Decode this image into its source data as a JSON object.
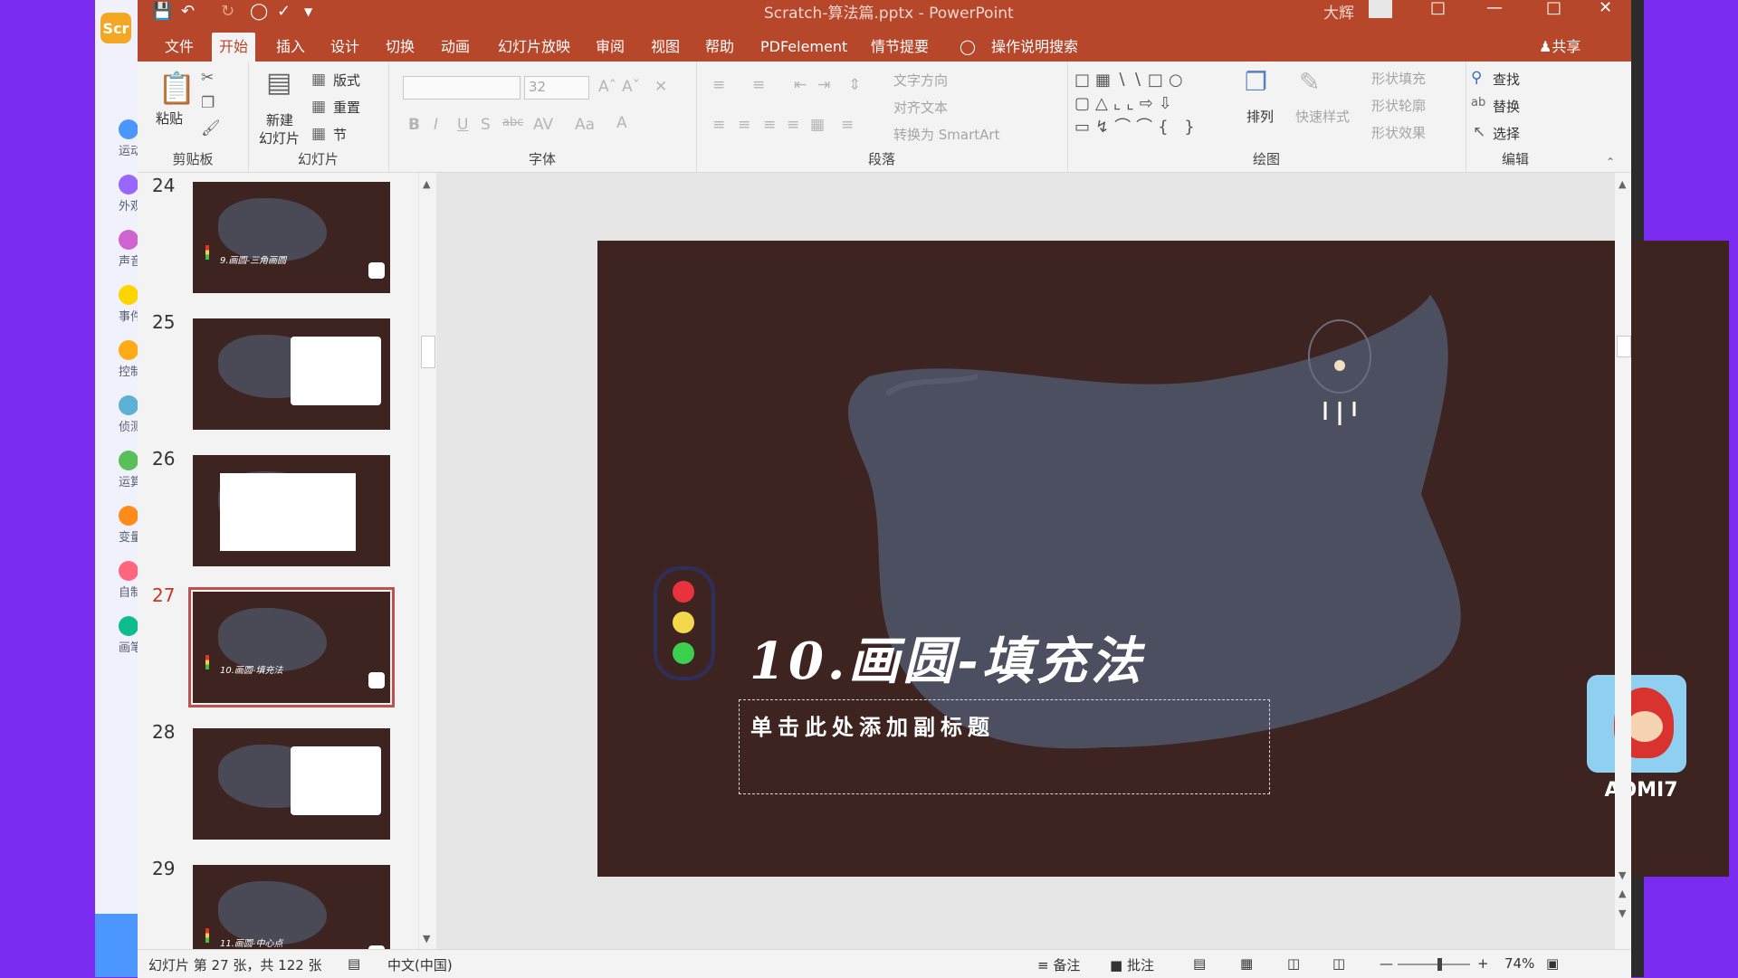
{
  "window": {
    "title": "Scratch-算法篇.pptx - PowerPoint",
    "user": "大辉"
  },
  "menu": {
    "items": [
      "文件",
      "开始",
      "插入",
      "设计",
      "切换",
      "动画",
      "幻灯片放映",
      "审阅",
      "视图",
      "帮助",
      "PDFelement",
      "情节提要"
    ],
    "active": "开始",
    "tell_me": "操作说明搜索",
    "share": "共享"
  },
  "ribbon": {
    "clipboard": {
      "label": "剪贴板",
      "paste": "粘贴"
    },
    "slides": {
      "label": "幻灯片",
      "new_slide_1": "新建",
      "new_slide_2": "幻灯片",
      "layout": "版式",
      "reset": "重置",
      "section": "节"
    },
    "font": {
      "label": "字体",
      "font_size": "32"
    },
    "paragraph": {
      "label": "段落",
      "text_direction": "文字方向",
      "align_text": "对齐文本",
      "smartart": "转换为 SmartArt"
    },
    "drawing": {
      "label": "绘图",
      "arrange": "排列",
      "quick_styles": "快速样式",
      "shape_fill": "形状填充",
      "shape_outline": "形状轮廓",
      "shape_effects": "形状效果"
    },
    "editing": {
      "label": "编辑",
      "find": "查找",
      "replace": "替换",
      "select": "选择"
    }
  },
  "thumbnails": [
    {
      "number": "24",
      "title": "9.画圆-三角画圆",
      "selected": false
    },
    {
      "number": "25",
      "title": "",
      "selected": false
    },
    {
      "number": "26",
      "title": "",
      "selected": false
    },
    {
      "number": "27",
      "title": "10.画圆-填充法",
      "selected": true
    },
    {
      "number": "28",
      "title": "",
      "selected": false
    },
    {
      "number": "29",
      "title": "11.画圆-中心点",
      "selected": false
    }
  ],
  "slide": {
    "title": "10.画圆-填充法",
    "subtitle_placeholder": "单击此处添加副标题",
    "brand_name": "AOMI7",
    "traffic_light_colors": [
      "#e8333f",
      "#f2d84a",
      "#3ccf4e"
    ],
    "background_color": "#3d2421"
  },
  "statusbar": {
    "slide_info": "幻灯片 第 27 张，共 122 张",
    "language": "中文(中国)",
    "notes": "备注",
    "comments": "批注",
    "zoom": "74%"
  },
  "scratch_sidebar": {
    "logo": "Scr",
    "categories": [
      {
        "label": "运动",
        "color": "#4c97ff"
      },
      {
        "label": "外观",
        "color": "#9966ff"
      },
      {
        "label": "声音",
        "color": "#cf63cf"
      },
      {
        "label": "事件",
        "color": "#ffd500"
      },
      {
        "label": "控制",
        "color": "#ffab19"
      },
      {
        "label": "侦测",
        "color": "#5cb1d6"
      },
      {
        "label": "运算",
        "color": "#59c059"
      },
      {
        "label": "变量",
        "color": "#ff8c1a"
      },
      {
        "label": "自制积木",
        "color": "#ff6680"
      },
      {
        "label": "画笔",
        "color": "#0fbd8c"
      }
    ]
  }
}
